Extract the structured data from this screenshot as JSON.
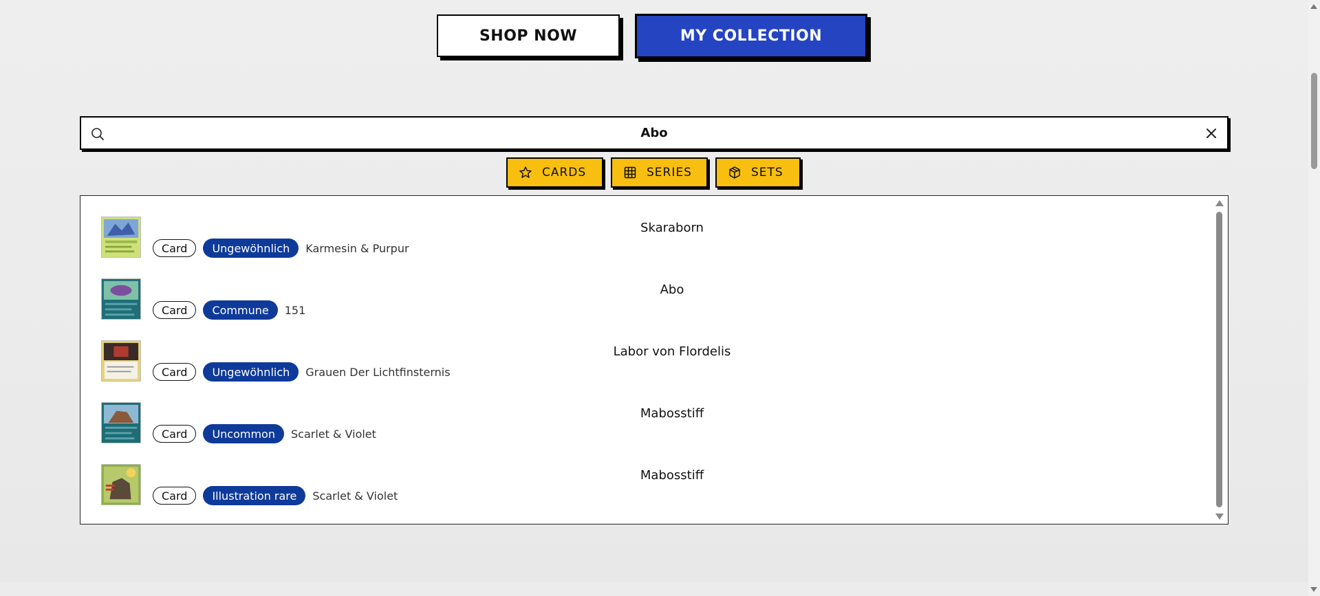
{
  "top_nav": {
    "shop_now_label": "SHOP NOW",
    "my_collection_label": "MY COLLECTION"
  },
  "search": {
    "value": "Abo",
    "placeholder": "",
    "search_icon": "search-icon",
    "clear_icon": "close-icon"
  },
  "filters": [
    {
      "label": "CARDS",
      "icon": "star-icon"
    },
    {
      "label": "SERIES",
      "icon": "grid-icon"
    },
    {
      "label": "SETS",
      "icon": "box-icon"
    }
  ],
  "results": [
    {
      "title": "Skaraborn",
      "type": "Card",
      "rarity": "Ungewöhnlich",
      "set": "Karmesin & Purpur"
    },
    {
      "title": "Abo",
      "type": "Card",
      "rarity": "Commune",
      "set": "151"
    },
    {
      "title": "Labor von Flordelis",
      "type": "Card",
      "rarity": "Ungewöhnlich",
      "set": "Grauen Der Lichtfinsternis"
    },
    {
      "title": "Mabosstiff",
      "type": "Card",
      "rarity": "Uncommon",
      "set": "Scarlet & Violet"
    },
    {
      "title": "Mabosstiff",
      "type": "Card",
      "rarity": "Illustration rare",
      "set": "Scarlet & Violet"
    }
  ],
  "colors": {
    "accent_blue": "#2544c2",
    "filter_yellow": "#f8bf10",
    "rarity_badge": "#0e3a9a"
  }
}
